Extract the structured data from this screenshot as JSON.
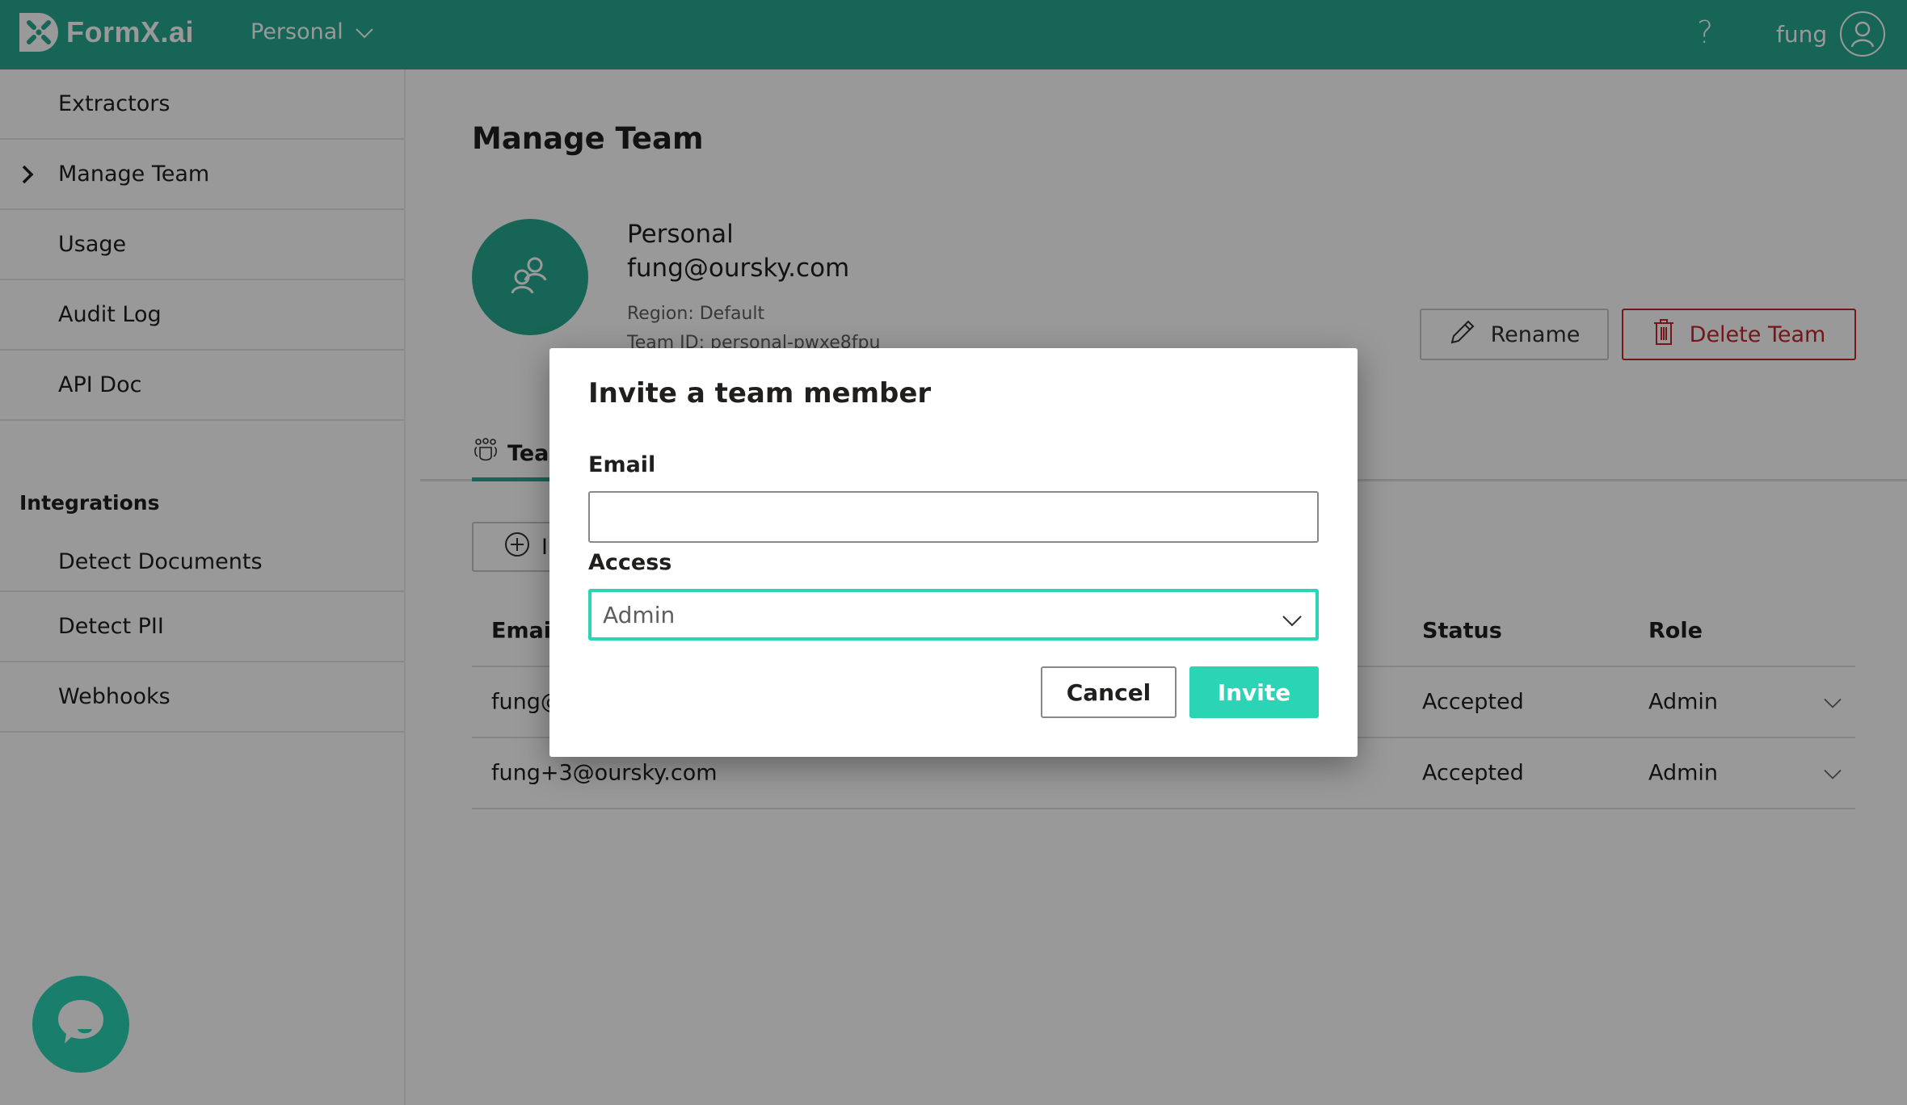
{
  "topbar": {
    "brand": "FormX.ai",
    "team_switcher": "Personal",
    "help_glyph": "?",
    "username": "fung",
    "icons": {
      "logo": "formx-logo-icon",
      "chevron": "chevron-down-icon",
      "help": "help-icon",
      "user": "user-avatar-icon"
    }
  },
  "sidebar": {
    "items": [
      {
        "label": "Extractors",
        "active": false
      },
      {
        "label": "Manage Team",
        "active": true
      },
      {
        "label": "Usage",
        "active": false
      },
      {
        "label": "Audit Log",
        "active": false
      },
      {
        "label": "API Doc",
        "active": false
      }
    ],
    "groups": [
      {
        "title": "Integrations",
        "items": [
          {
            "label": "Detect Documents"
          },
          {
            "label": "Detect PII"
          },
          {
            "label": "Webhooks"
          }
        ]
      }
    ]
  },
  "main": {
    "title": "Manage Team",
    "team": {
      "name": "Personal",
      "email": "fung@oursky.com",
      "region": "Region: Default",
      "team_id": "Team ID: personal-pwxe8fpu"
    },
    "actions": {
      "rename": "Rename",
      "delete": "Delete Team"
    },
    "tabs": [
      {
        "label": "Team"
      }
    ],
    "add_button": "Invite",
    "table": {
      "columns": [
        "Email",
        "Status",
        "Role"
      ],
      "rows": [
        {
          "email": "fung@oursky.com",
          "status": "Accepted",
          "role": "Admin"
        },
        {
          "email": "fung+3@oursky.com",
          "status": "Accepted",
          "role": "Admin"
        }
      ]
    }
  },
  "modal": {
    "title": "Invite a team member",
    "email_label": "Email",
    "email_value": "",
    "email_placeholder": "",
    "access_label": "Access",
    "access_value": "Admin",
    "cancel": "Cancel",
    "invite": "Invite"
  },
  "colors": {
    "brand_teal": "#25a88f",
    "accent_teal": "#2bd4b4",
    "danger": "#c4262e"
  }
}
